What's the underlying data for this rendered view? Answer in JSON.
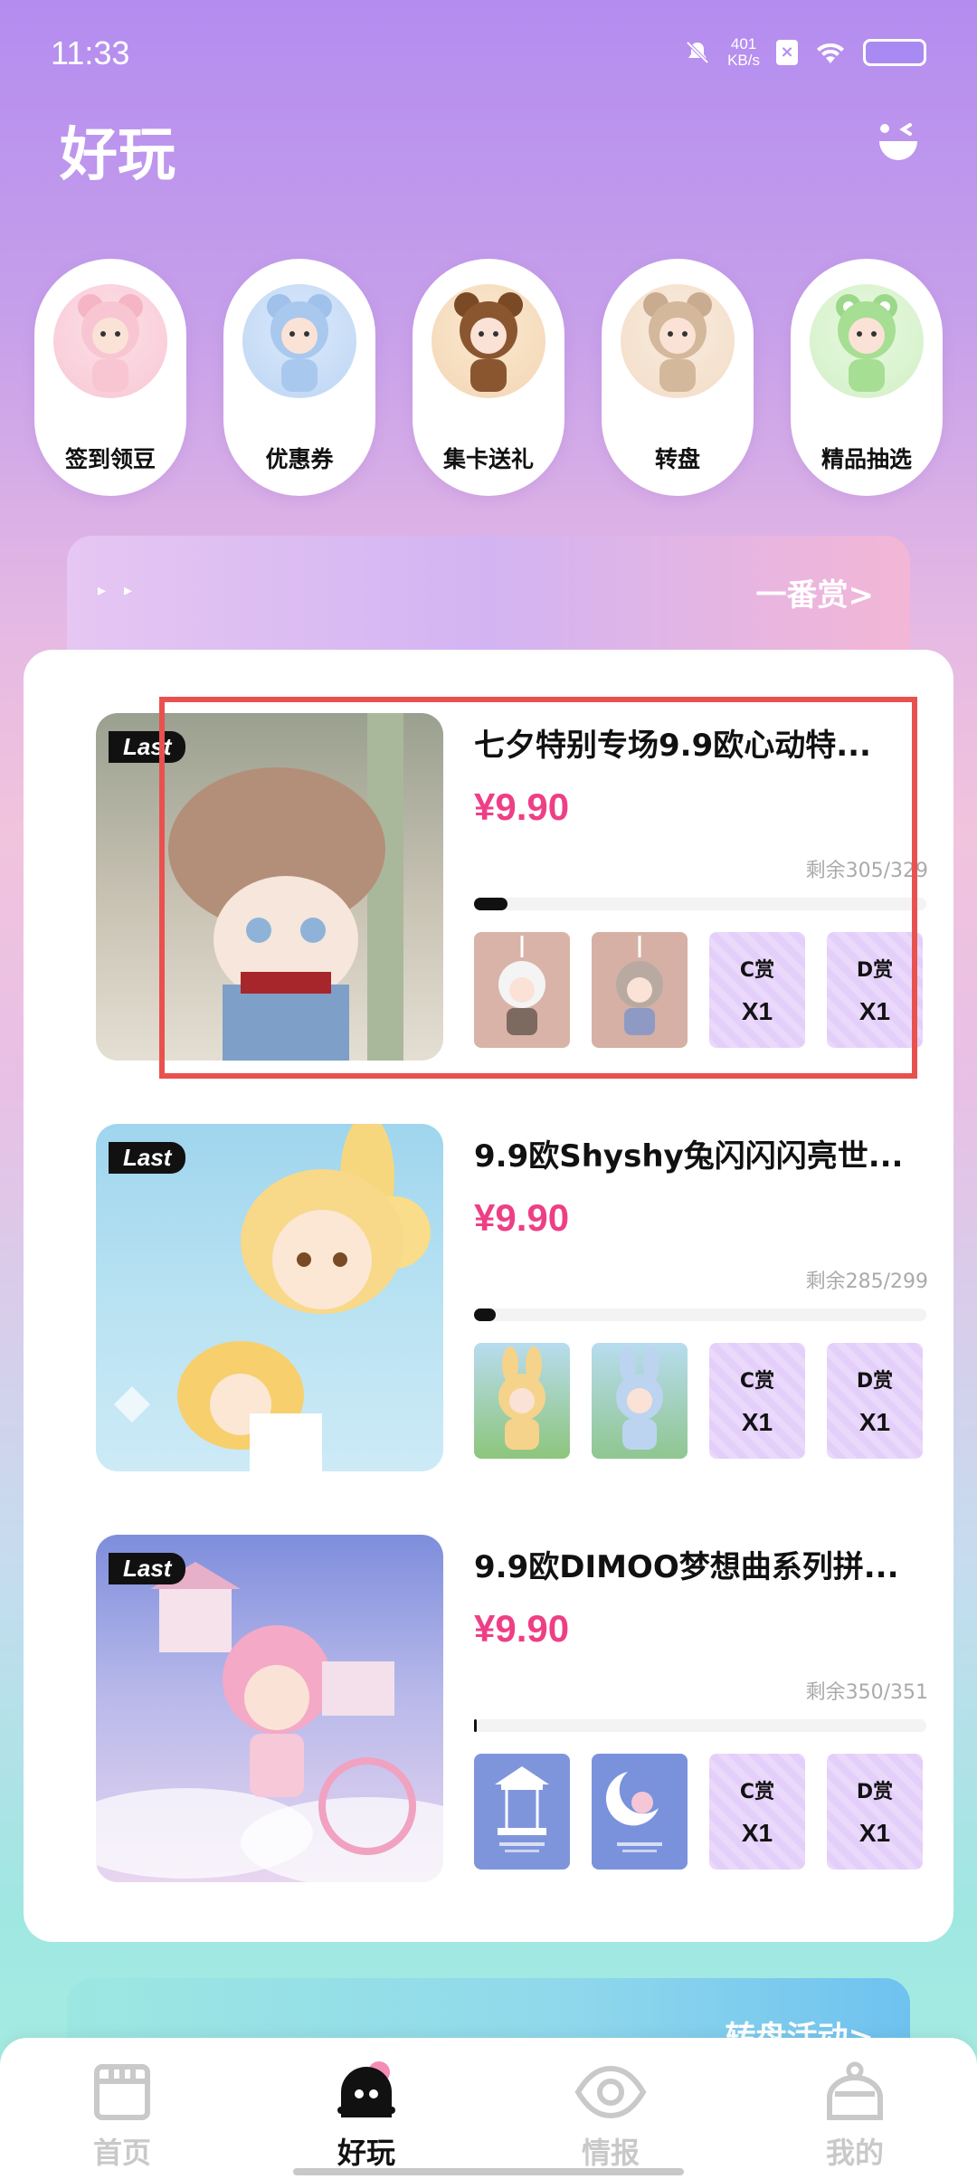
{
  "status_bar": {
    "time": "11:33",
    "net_speed": "401",
    "net_unit": "KB/s"
  },
  "page_title": "好玩",
  "categories": [
    {
      "label": "签到领豆",
      "color": "#f7c7d4"
    },
    {
      "label": "优惠券",
      "color": "#bcd5f3"
    },
    {
      "label": "集卡送礼",
      "color": "#f3d6b4"
    },
    {
      "label": "转盘",
      "color": "#f2dcc6"
    },
    {
      "label": "精品抽选",
      "color": "#d2f0c6"
    }
  ],
  "banner": {
    "label": "一番赏>"
  },
  "items": [
    {
      "badge": "Last",
      "title": "七夕特别专场9.9欧心动特...",
      "price": "¥9.90",
      "remaining": "剩余305/329",
      "progress_fraction": 0.073,
      "prizes": [
        {
          "type": "image",
          "color": "#d9b3a7"
        },
        {
          "type": "image",
          "color": "#d6b0a4"
        },
        {
          "type": "grade",
          "grade": "C赏",
          "qty": "X1"
        },
        {
          "type": "grade",
          "grade": "D赏",
          "qty": "X1"
        }
      ]
    },
    {
      "badge": "Last",
      "title": "9.9欧Shyshy兔闪闪闪亮世...",
      "price": "¥9.90",
      "remaining": "剩余285/299",
      "progress_fraction": 0.047,
      "prizes": [
        {
          "type": "image",
          "color": "#9fcd8d"
        },
        {
          "type": "image",
          "color": "#9cc6a6"
        },
        {
          "type": "grade",
          "grade": "C赏",
          "qty": "X1"
        },
        {
          "type": "grade",
          "grade": "D赏",
          "qty": "X1"
        }
      ]
    },
    {
      "badge": "Last",
      "title": "9.9欧DIMOO梦想曲系列拼...",
      "price": "¥9.90",
      "remaining": "剩余350/351",
      "progress_fraction": 0.003,
      "prizes": [
        {
          "type": "image",
          "color": "#7f95db"
        },
        {
          "type": "image",
          "color": "#7a92dc"
        },
        {
          "type": "grade",
          "grade": "C赏",
          "qty": "X1"
        },
        {
          "type": "grade",
          "grade": "D赏",
          "qty": "X1"
        }
      ]
    }
  ],
  "banner2": {
    "label": "转盘活动>"
  },
  "nav": [
    {
      "label": "首页",
      "icon": "store-icon",
      "active": false
    },
    {
      "label": "好玩",
      "icon": "mascot-icon",
      "active": true
    },
    {
      "label": "情报",
      "icon": "eye-icon",
      "active": false
    },
    {
      "label": "我的",
      "icon": "profile-icon",
      "active": false
    }
  ]
}
